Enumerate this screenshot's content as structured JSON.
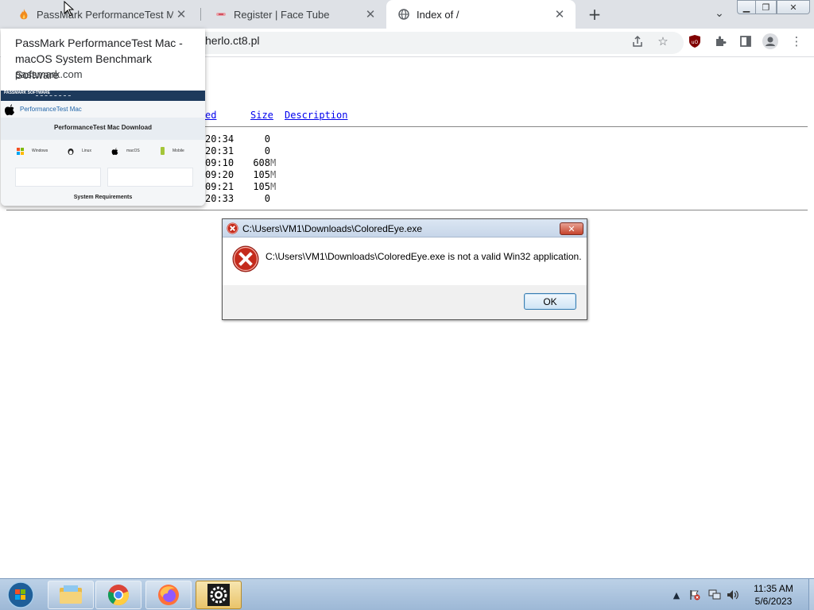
{
  "browser": {
    "tabs": [
      {
        "title": "PassMark PerformanceTest Mac -",
        "favicon": "passmark-flame-icon"
      },
      {
        "title": "Register | Face Tube",
        "favicon": "facetube-icon"
      },
      {
        "title": "Index of /",
        "favicon": "globe-icon"
      }
    ],
    "url": "herlo.ct8.pl"
  },
  "page": {
    "columns": [
      "ed",
      "Size",
      "Description"
    ],
    "rows": [
      {
        "time": "20:34",
        "size": "0",
        "unit": ""
      },
      {
        "time": "20:31",
        "size": "0",
        "unit": ""
      },
      {
        "time": "09:10",
        "size": "608",
        "unit": "M"
      },
      {
        "time": "09:20",
        "size": "105",
        "unit": "M"
      },
      {
        "time": "09:21",
        "size": "105",
        "unit": "M"
      },
      {
        "time": "20:33",
        "size": "0",
        "unit": ""
      }
    ]
  },
  "hovercard": {
    "title": "PassMark PerformanceTest Mac - macOS System Benchmark Software",
    "domain": "passmark.com",
    "thumbnail": {
      "brand": "PASSMARK SOFTWARE",
      "product": "PerformanceTest Mac",
      "heading": "PerformanceTest Mac Download",
      "platforms": [
        "Windows",
        "Linux",
        "macOS",
        "Mobile"
      ],
      "requirements": "System Requirements"
    }
  },
  "dialog": {
    "title": "C:\\Users\\VM1\\Downloads\\ColoredEye.exe",
    "message": "C:\\Users\\VM1\\Downloads\\ColoredEye.exe is not a valid Win32 application.",
    "ok_label": "OK"
  },
  "taskbar": {
    "time": "11:35 AM",
    "date": "5/6/2023"
  },
  "colors": {
    "link": "#0000ee",
    "dialog_error": "#c5432c",
    "taskbar": "#9db8d6"
  }
}
